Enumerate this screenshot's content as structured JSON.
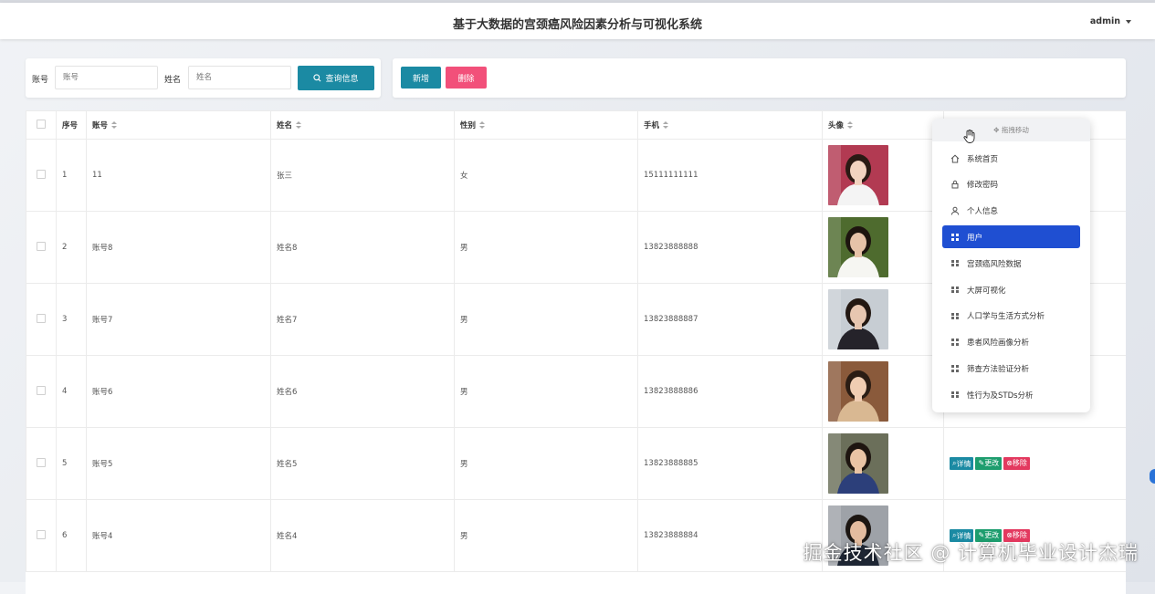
{
  "header": {
    "title": "基于大数据的宫颈癌风险因素分析与可视化系统",
    "user": "admin"
  },
  "search": {
    "account_label": "账号",
    "account_placeholder": "账号",
    "name_label": "姓名",
    "name_placeholder": "姓名",
    "search_button": "查询信息"
  },
  "toolbar": {
    "add_label": "新增",
    "delete_label": "删除"
  },
  "table": {
    "columns": [
      "序号",
      "账号",
      "姓名",
      "性别",
      "手机",
      "头像"
    ],
    "rows": [
      {
        "index": "1",
        "account": "11",
        "name": "张三",
        "gender": "女",
        "phone": "15111111111"
      },
      {
        "index": "2",
        "account": "账号8",
        "name": "姓名8",
        "gender": "男",
        "phone": "13823888888"
      },
      {
        "index": "3",
        "account": "账号7",
        "name": "姓名7",
        "gender": "男",
        "phone": "13823888887"
      },
      {
        "index": "4",
        "account": "账号6",
        "name": "姓名6",
        "gender": "男",
        "phone": "13823888886"
      },
      {
        "index": "5",
        "account": "账号5",
        "name": "姓名5",
        "gender": "男",
        "phone": "13823888885"
      },
      {
        "index": "6",
        "account": "账号4",
        "name": "姓名4",
        "gender": "男",
        "phone": "13823888884"
      }
    ],
    "actions": {
      "view": "详情",
      "edit": "更改",
      "remove": "移除"
    }
  },
  "menu": {
    "drag_label": "拖拽移动",
    "items": [
      {
        "label": "系统首页",
        "icon": "home-icon"
      },
      {
        "label": "修改密码",
        "icon": "lock-icon"
      },
      {
        "label": "个人信息",
        "icon": "user-icon"
      },
      {
        "label": "用户",
        "icon": "grid-icon",
        "active": true
      },
      {
        "label": "宫颈癌风险数据",
        "icon": "grid-icon"
      },
      {
        "label": "大屏可视化",
        "icon": "grid-icon"
      },
      {
        "label": "人口学与生活方式分析",
        "icon": "grid-icon"
      },
      {
        "label": "患者风险画像分析",
        "icon": "grid-icon"
      },
      {
        "label": "筛查方法验证分析",
        "icon": "grid-icon"
      },
      {
        "label": "性行为及STDs分析",
        "icon": "grid-icon"
      }
    ]
  },
  "watermark": "掘金技术社区 @ 计算机毕业设计杰瑞",
  "colors": {
    "primary": "#1b8aa3",
    "danger": "#f2507a",
    "menu_active": "#1f4fd2",
    "edit": "#1d9d6e"
  }
}
